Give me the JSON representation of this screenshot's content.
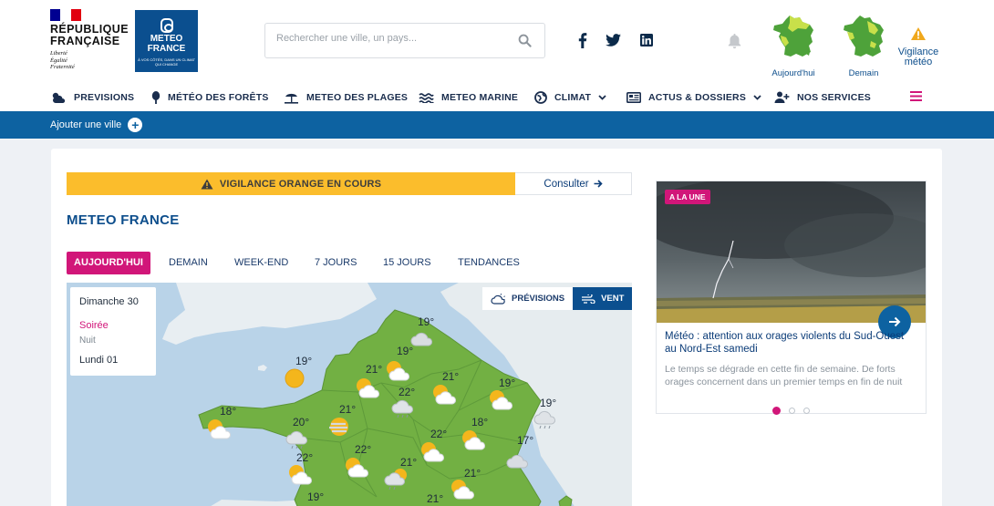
{
  "header": {
    "rf_line1": "RÉPUBLIQUE",
    "rf_line2": "FRANÇAISE",
    "rf_motto": [
      "Liberté",
      "Égalité",
      "Fraternité"
    ],
    "logo_line1": "METEO",
    "logo_line2": "FRANCE",
    "logo_tagline": "À VOS CÔTÉS, DANS UN CLIMAT QUI CHANGE",
    "search_placeholder": "Rechercher une ville, un pays...",
    "social": [
      "facebook-icon",
      "twitter-icon",
      "linkedin-icon"
    ],
    "vigilance_today": "Aujourd'hui",
    "vigilance_tomorrow": "Demain",
    "vigilance_label": "Vigilance météo"
  },
  "nav": {
    "items": [
      {
        "label": "PREVISIONS",
        "icon": "cloud-sun-icon"
      },
      {
        "label": "MÉTÉO DES FORÊTS",
        "icon": "tree-icon"
      },
      {
        "label": "METEO DES PLAGES",
        "icon": "beach-icon"
      },
      {
        "label": "METEO MARINE",
        "icon": "waves-icon"
      },
      {
        "label": "CLIMAT",
        "icon": "globe-icon"
      },
      {
        "label": "ACTUS & DOSSIERS",
        "icon": "newspaper-icon"
      },
      {
        "label": "NOS SERVICES",
        "icon": "user-plus-icon"
      }
    ]
  },
  "bluebar": {
    "add_city": "Ajouter une ville"
  },
  "vigilance_banner": {
    "text": "VIGILANCE ORANGE EN COURS",
    "action": "Consulter"
  },
  "page_title": "METEO FRANCE",
  "tabs": [
    "AUJOURD'HUI",
    "DEMAIN",
    "WEEK-END",
    "7 JOURS",
    "15 JOURS",
    "TENDANCES"
  ],
  "map": {
    "days": {
      "day1": "Dimanche 30",
      "period_active": "Soirée",
      "period_next": "Nuit",
      "day2": "Lundi 01"
    },
    "toggle": {
      "previsions": "PRÉVISIONS",
      "vent": "VENT"
    },
    "temps": [
      "19°",
      "19°",
      "19°",
      "21°",
      "21°",
      "19°",
      "19°",
      "18°",
      "21°",
      "22°",
      "20°",
      "18°",
      "22°",
      "22°",
      "17°",
      "22°",
      "21°",
      "21°",
      "19°",
      "21°"
    ]
  },
  "news": {
    "badge": "A LA UNE",
    "headline": "Météo : attention aux orages violents du Sud-Ouest au Nord-Est samedi",
    "excerpt": "Le temps se dégrade en cette fin de semaine. De forts orages concernent dans un premier temps en fin de nuit"
  },
  "colors": {
    "accent_pink": "#d11679",
    "brand_blue": "#0d62a1",
    "vigilance_orange": "#fbbd2c",
    "map_green": "#72b043"
  }
}
